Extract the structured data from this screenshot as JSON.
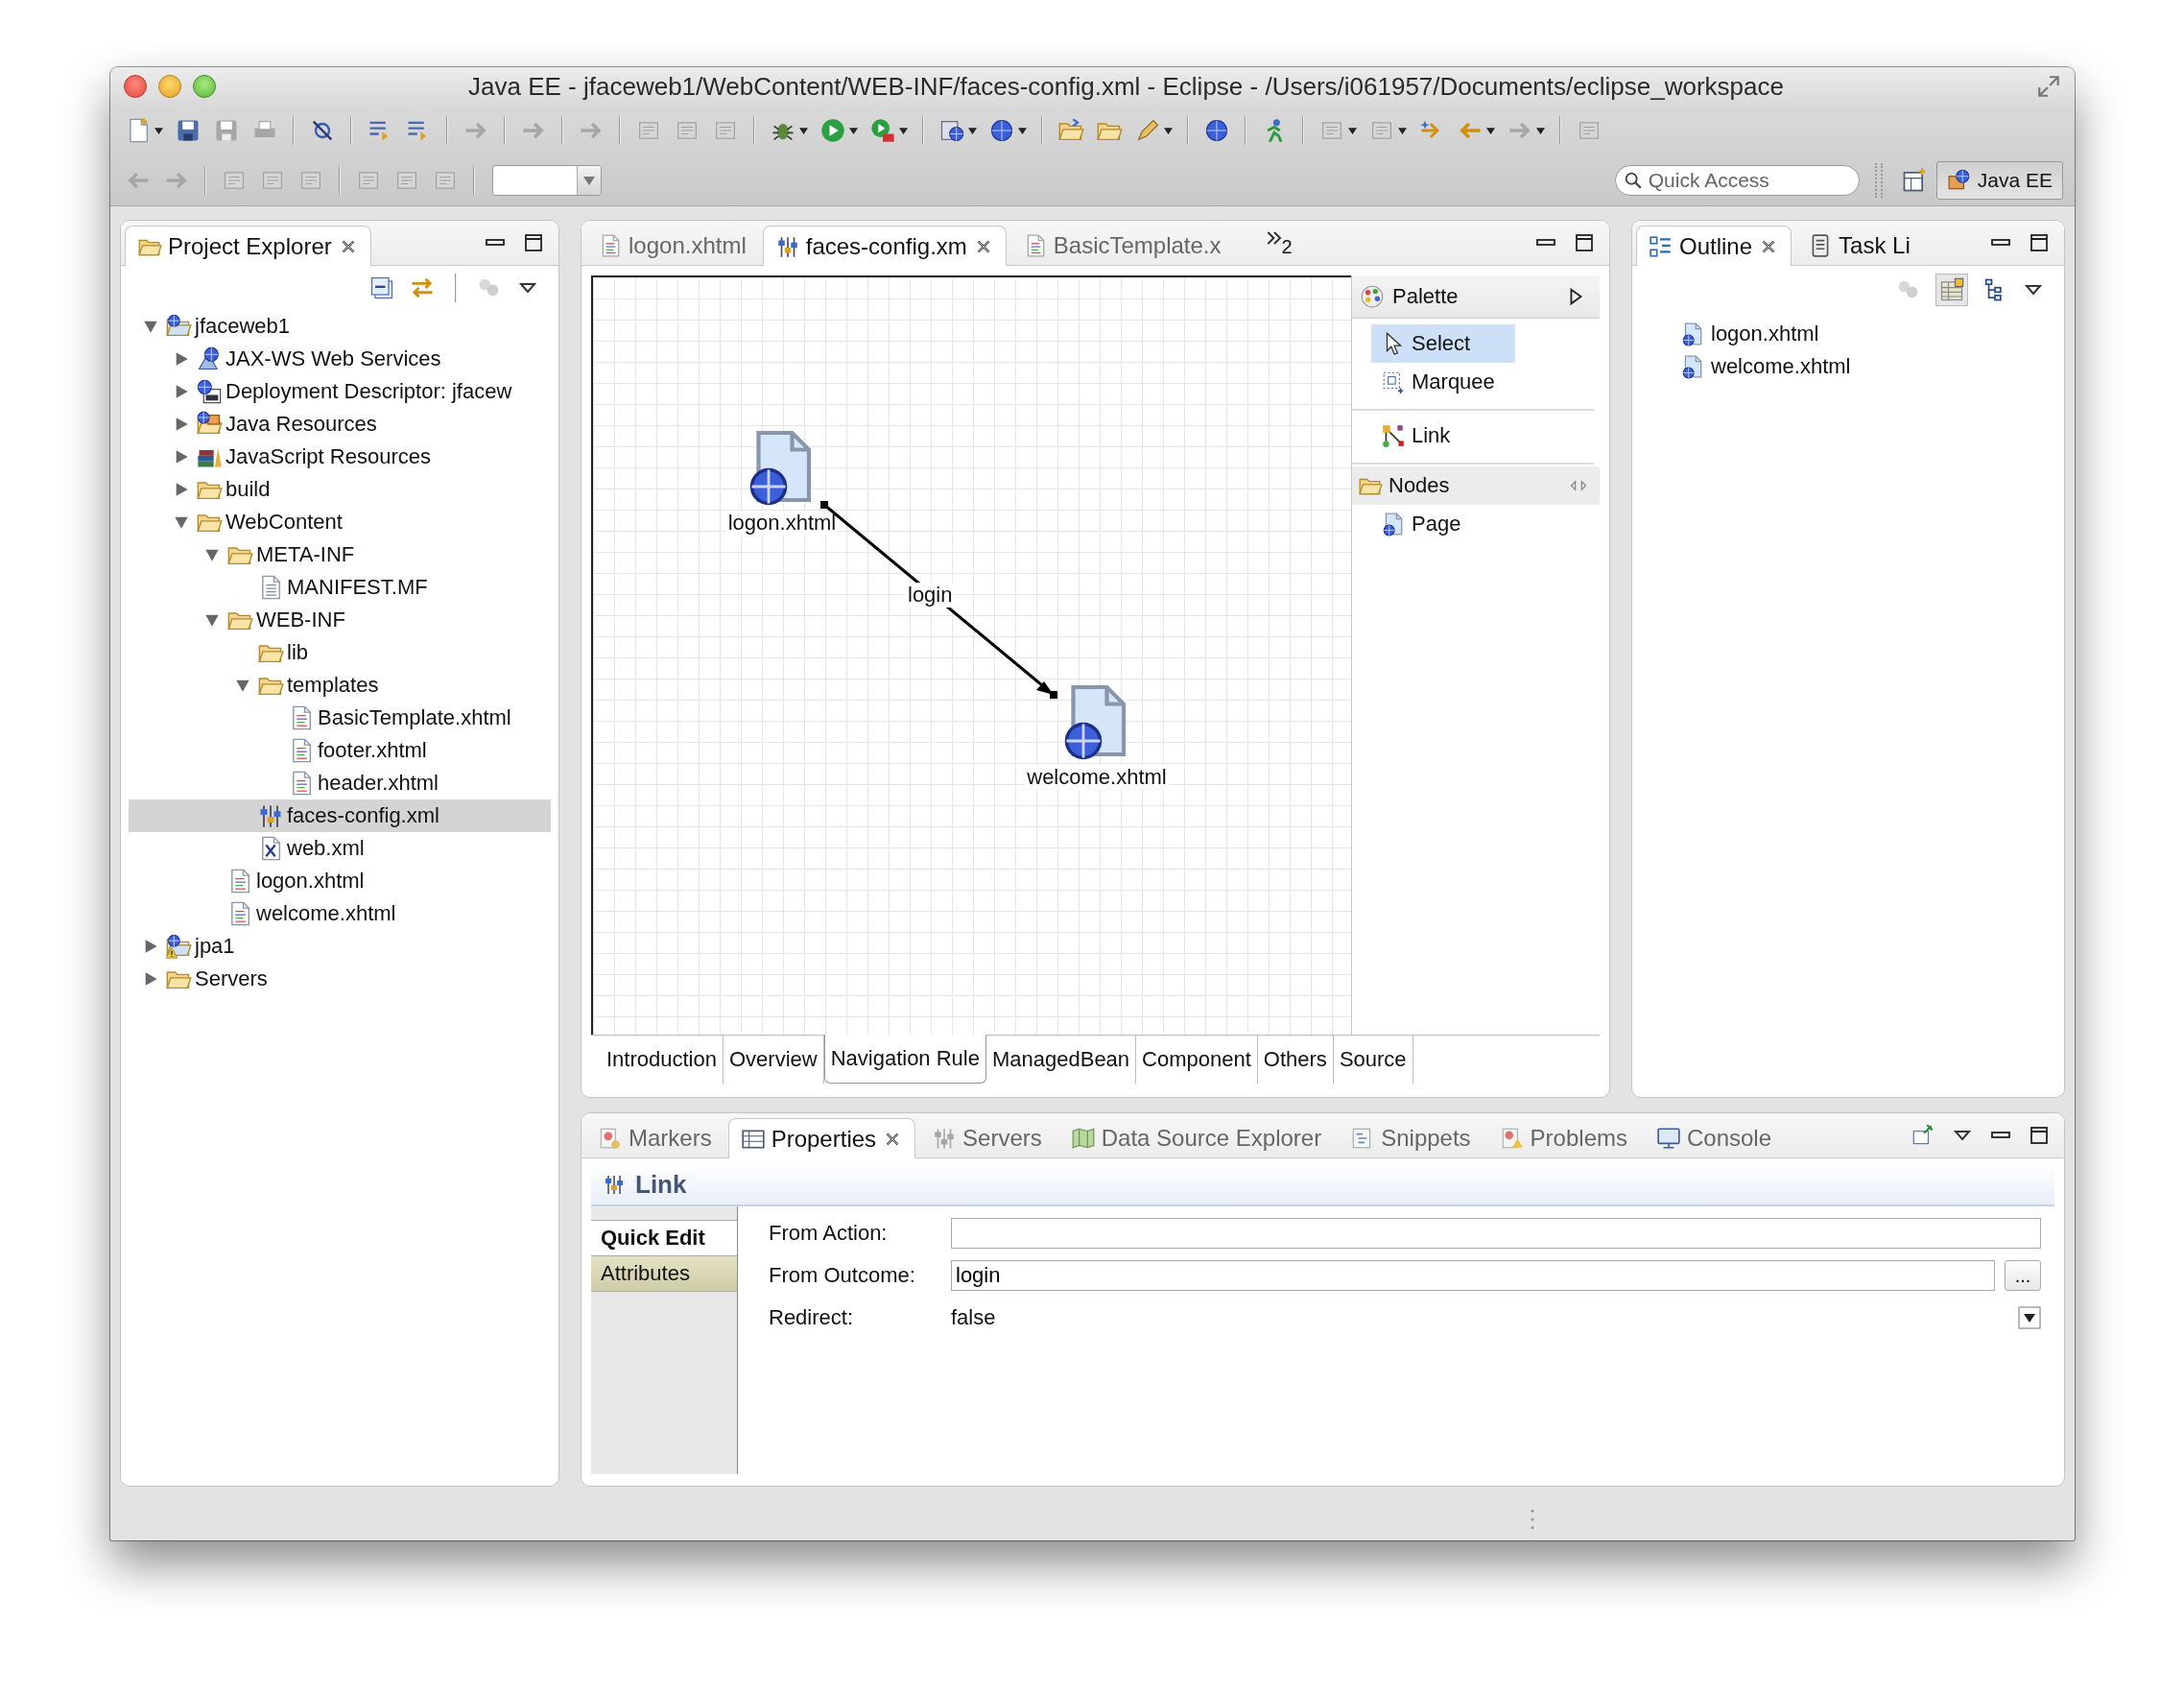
{
  "window": {
    "title": "Java EE - jfaceweb1/WebContent/WEB-INF/faces-config.xml - Eclipse - /Users/i061957/Documents/eclipse_workspace"
  },
  "toolbar": {
    "quick_access": {
      "placeholder": "Quick Access"
    },
    "perspective": "Java EE"
  },
  "project_explorer": {
    "tab": {
      "label": "Project Explorer",
      "selected": true
    },
    "tree": [
      {
        "label": "jfaceweb1",
        "kind": "project",
        "warning": false,
        "expanded": true,
        "selected": false,
        "children": [
          {
            "label": "JAX-WS Web Services",
            "kind": "web-services",
            "expanded": false,
            "selected": false
          },
          {
            "label": "Deployment Descriptor: jfacew",
            "kind": "descriptor",
            "expanded": false,
            "selected": false
          },
          {
            "label": "Java Resources",
            "kind": "java-resources",
            "expanded": false,
            "selected": false
          },
          {
            "label": "JavaScript Resources",
            "kind": "js-resources",
            "expanded": false,
            "selected": false
          },
          {
            "label": "build",
            "kind": "folder",
            "expanded": false,
            "selected": false
          },
          {
            "label": "WebContent",
            "kind": "folder",
            "expanded": true,
            "selected": false,
            "children": [
              {
                "label": "META-INF",
                "kind": "folder",
                "expanded": true,
                "selected": false,
                "children": [
                  {
                    "label": "MANIFEST.MF",
                    "kind": "text-file",
                    "selected": false
                  }
                ]
              },
              {
                "label": "WEB-INF",
                "kind": "folder",
                "expanded": true,
                "selected": false,
                "children": [
                  {
                    "label": "lib",
                    "kind": "folder",
                    "selected": false
                  },
                  {
                    "label": "templates",
                    "kind": "folder",
                    "expanded": true,
                    "selected": false,
                    "children": [
                      {
                        "label": "BasicTemplate.xhtml",
                        "kind": "markup-file",
                        "selected": false
                      },
                      {
                        "label": "footer.xhtml",
                        "kind": "markup-file",
                        "selected": false
                      },
                      {
                        "label": "header.xhtml",
                        "kind": "markup-file",
                        "selected": false
                      }
                    ]
                  },
                  {
                    "label": "faces-config.xml",
                    "kind": "config-file",
                    "selected": true
                  },
                  {
                    "label": "web.xml",
                    "kind": "xml-file",
                    "selected": false
                  }
                ]
              },
              {
                "label": "logon.xhtml",
                "kind": "markup-file",
                "selected": false
              },
              {
                "label": "welcome.xhtml",
                "kind": "markup-file",
                "selected": false
              }
            ]
          }
        ]
      },
      {
        "label": "jpa1",
        "kind": "project",
        "warning": true,
        "expanded": false,
        "selected": false
      },
      {
        "label": "Servers",
        "kind": "folder",
        "expanded": false,
        "selected": false
      }
    ]
  },
  "editor": {
    "tabs": [
      {
        "label": "logon.xhtml",
        "kind": "markup-file",
        "selected": false
      },
      {
        "label": "faces-config.xm",
        "kind": "config-file",
        "selected": true
      },
      {
        "label": "BasicTemplate.x",
        "kind": "markup-file",
        "selected": false
      }
    ],
    "overflow_count": "2",
    "diagram": {
      "nodes": [
        {
          "label": "logon.xhtml"
        },
        {
          "label": "welcome.xhtml"
        }
      ],
      "links": [
        {
          "label": "login"
        }
      ]
    },
    "palette": {
      "title": "Palette",
      "tool_groups": [
        {
          "tools": [
            {
              "label": "Select",
              "kind": "select",
              "selected": true
            },
            {
              "label": "Marquee",
              "kind": "marquee",
              "selected": false
            }
          ]
        },
        {
          "tools": [
            {
              "label": "Link",
              "kind": "connection",
              "selected": false
            }
          ]
        }
      ],
      "drawers": [
        {
          "label": "Nodes",
          "items": [
            {
              "label": "Page",
              "kind": "page",
              "selected": false
            }
          ]
        }
      ]
    },
    "page_tabs": [
      {
        "label": "Introduction",
        "selected": false
      },
      {
        "label": "Overview",
        "selected": false
      },
      {
        "label": "Navigation Rule",
        "selected": true
      },
      {
        "label": "ManagedBean",
        "selected": false
      },
      {
        "label": "Component",
        "selected": false
      },
      {
        "label": "Others",
        "selected": false
      },
      {
        "label": "Source",
        "selected": false
      }
    ]
  },
  "outline": {
    "tabs": [
      {
        "label": "Outline",
        "kind": "outline",
        "selected": true
      },
      {
        "label": "Task Li",
        "kind": "task-list",
        "selected": false
      }
    ],
    "items": [
      {
        "label": "logon.xhtml"
      },
      {
        "label": "welcome.xhtml"
      }
    ]
  },
  "properties": {
    "tabs": [
      {
        "label": "Markers",
        "kind": "markers",
        "selected": false
      },
      {
        "label": "Properties",
        "kind": "properties",
        "selected": true
      },
      {
        "label": "Servers",
        "kind": "servers",
        "selected": false
      },
      {
        "label": "Data Source Explorer",
        "kind": "datasource",
        "selected": false
      },
      {
        "label": "Snippets",
        "kind": "snippets",
        "selected": false
      },
      {
        "label": "Problems",
        "kind": "problems",
        "selected": false
      },
      {
        "label": "Console",
        "kind": "console",
        "selected": false
      }
    ],
    "section_title": "Link",
    "side_tabs": [
      {
        "label": "Quick Edit",
        "selected": true
      },
      {
        "label": "Attributes",
        "selected": false
      }
    ],
    "fields": [
      {
        "label": "From Action:",
        "kind": "text"
      },
      {
        "label": "From Outcome:",
        "kind": "text",
        "value": "login",
        "browse": "..."
      },
      {
        "label": "Redirect:",
        "kind": "select",
        "value": "false"
      }
    ]
  }
}
